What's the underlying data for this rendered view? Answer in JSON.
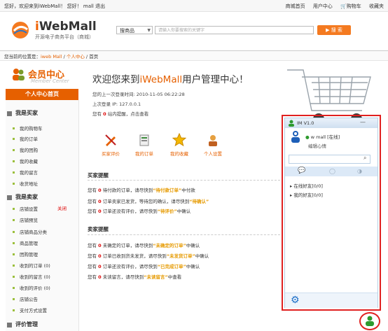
{
  "topbar": {
    "greeting": "您好，欢迎来到iWebMall！ 您好！ mall 退出",
    "links": [
      "商城首页",
      "用户中心",
      "购物车",
      "收藏夹"
    ]
  },
  "header": {
    "brand": "iWebMall",
    "tagline": "开源电子商务平台（商城）",
    "category_select": "搜商品",
    "search_placeholder": "请输入你要搜索的关键字",
    "search_button": "搜  索"
  },
  "breadcrumb": {
    "prefix": "您当前的位置是：",
    "items": [
      "iweb Mall",
      "个人中心",
      "首页"
    ]
  },
  "member_center": {
    "title": "会员中心",
    "subtitle": "Member Center",
    "home_button": "个人中心首页"
  },
  "sidebar": {
    "sections": [
      {
        "label": "我是买家",
        "items": [
          "我的购物车",
          "我的订单",
          "我的团购",
          "我的收藏",
          "我的留言",
          "收货地址"
        ]
      },
      {
        "label": "我是卖家",
        "items": [
          "店铺设置",
          "店铺预览",
          "店铺商品分类",
          "商品管理",
          "团购管理",
          "收到的订单 (0)",
          "收到的留言 (0)",
          "收到的评价 (0)",
          "店铺公告",
          "支付方式设置"
        ]
      },
      {
        "label": "评价管理",
        "items": []
      }
    ],
    "closed_label": "关闭"
  },
  "main": {
    "welcome_pre": "欢迎您来到",
    "welcome_brand": "iWebMall",
    "welcome_post": "用户管理中心！",
    "last_login_time": "您的上一次登录时间: 2010-11-05 06:22:28",
    "last_login_ip": "上次登录 IP: 127.0.0.1",
    "msg_pre": "您有",
    "msg_count": "0",
    "msg_post": "站内提醒，点击查看",
    "shortcuts": [
      "买家评价",
      "我的订单",
      "我的收藏",
      "个人设置"
    ],
    "buyer_heading": "买家提醒",
    "buyer_lines": [
      {
        "pre": "您有",
        "n": "0",
        "mid": "待付款的订单，请尽快到",
        "link": "“待付款订单”",
        "post": "中付款"
      },
      {
        "pre": "您有",
        "n": "0",
        "mid": "订单卖家已发货，等待您的确认，请尽快到",
        "link": "“待确认”",
        "post": ""
      },
      {
        "pre": "您有",
        "n": "0",
        "mid": "订单还没有评价，请尽快到",
        "link": "“待评价”",
        "post": "中确认"
      }
    ],
    "seller_heading": "卖家提醒",
    "seller_lines": [
      {
        "pre": "您有",
        "n": "0",
        "mid": "未确定的订单，请尽快到",
        "link": "“未确定的订单”",
        "post": "中确认"
      },
      {
        "pre": "您有",
        "n": "0",
        "mid": "订单已收到货未发货，请尽快到",
        "link": "“未发货订单”",
        "post": "中确认"
      },
      {
        "pre": "您有",
        "n": "0",
        "mid": "订单还没有评价，请尽快到",
        "link": "“已完成订单”",
        "post": "中确认"
      },
      {
        "pre": "您有",
        "n": "0",
        "mid": "未读留言，请尽快到",
        "link": "“未读留言”",
        "post": "中查看"
      }
    ]
  },
  "im": {
    "title": "IM V1.0",
    "user": "w mall [在线]",
    "signature": "编辑心情",
    "groups": [
      "在线好友[0/0]",
      "我的好友[0/0]"
    ]
  },
  "colors": {
    "accent": "#e66000",
    "highlight_frame": "#e02020",
    "link": "#e69a00"
  }
}
